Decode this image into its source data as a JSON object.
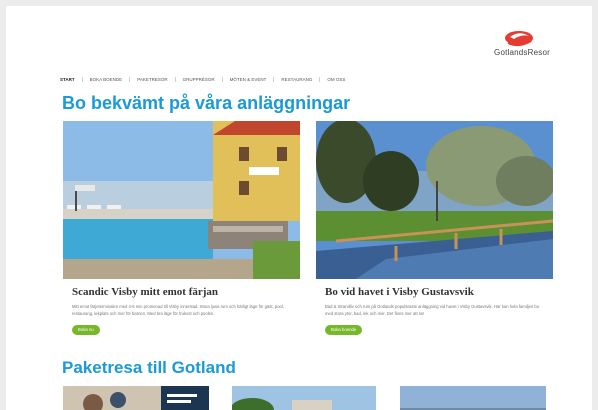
{
  "brand": {
    "name": "GotlandsResor",
    "accent": "#1a9ad6",
    "logo_red": "#e53b30",
    "button_green": "#77b82a"
  },
  "nav": {
    "items": [
      "Start",
      "Boka boende",
      "Paketresor",
      "Grupprésor",
      "Möten & event",
      "Restaurang",
      "Om oss"
    ]
  },
  "section1": {
    "heading": "Bo bekvämt på våra anläggningar"
  },
  "cards": [
    {
      "title": "Scandic Visby mitt emot färjan",
      "desc": "Mitt emot färjeterminalen med 4-5 min promenad till Visby innerstad. Stora ljusa rum och härligt läge för gäst, pool, restaurang, lekplats och mer för barnen. Med bra läge för frukost och poolen.",
      "button": "Boka nu"
    },
    {
      "title": "Bo vid havet i Visby Gustavsvik",
      "desc": "Bad & Strandliv och rum på Gotlands populäraste anläggning vid havet i Visby Gustavsvik. Här kan hela familjen bo med stora ytor, bad, lek och mer. Det finns mer att se!",
      "button": "Boka boende"
    }
  ],
  "section2": {
    "heading": "Paketresa till Gotland"
  }
}
